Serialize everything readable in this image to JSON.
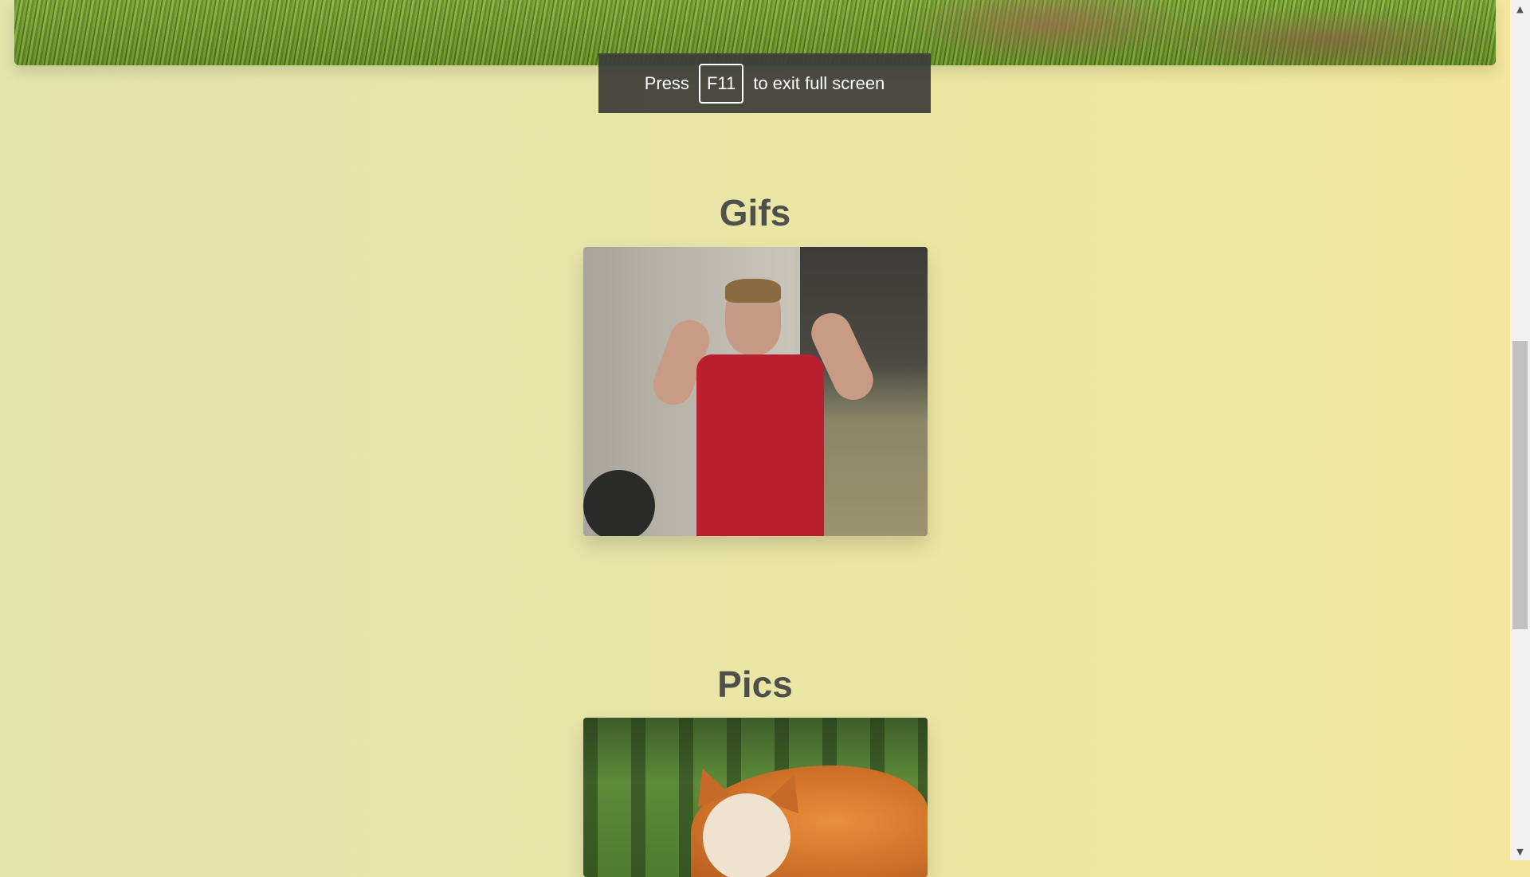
{
  "fullscreen_toast": {
    "prefix": "Press",
    "key": "F11",
    "suffix": "to exit full screen"
  },
  "sections": {
    "gifs": {
      "title": "Gifs"
    },
    "pics": {
      "title": "Pics"
    }
  },
  "scrollbar": {
    "up_icon": "▲",
    "down_icon": "▼"
  },
  "colors": {
    "background_left": "#e1e4ab",
    "background_right": "#f4e69a",
    "title": "#4f4f4c",
    "toast_bg": "#3c3c3a"
  }
}
